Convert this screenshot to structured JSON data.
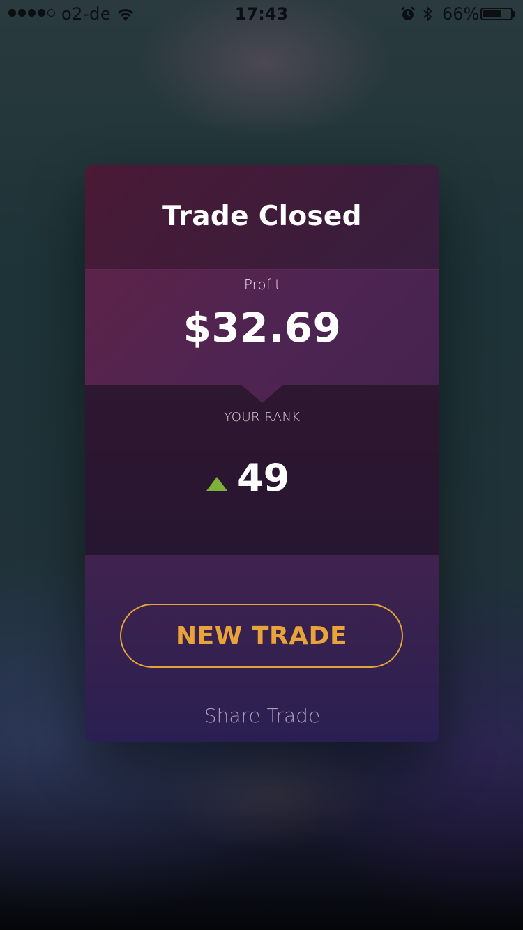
{
  "status_bar": {
    "signal_dots_filled": 4,
    "signal_dots_total": 5,
    "carrier": "o2-de",
    "time": "17:43",
    "battery_percent": "66%",
    "battery_level": 0.66,
    "icons": [
      "wifi-icon",
      "alarm-icon",
      "bluetooth-icon",
      "battery-icon"
    ]
  },
  "card": {
    "title": "Trade Closed",
    "profit_label": "Profit",
    "profit_value": "$32.69",
    "rank_label": "YOUR RANK",
    "rank_value": "49",
    "rank_trend": "up",
    "new_trade_label": "NEW TRADE",
    "share_label": "Share Trade"
  },
  "colors": {
    "accent": "#e8a33a",
    "rank_up": "#7fb13a"
  }
}
